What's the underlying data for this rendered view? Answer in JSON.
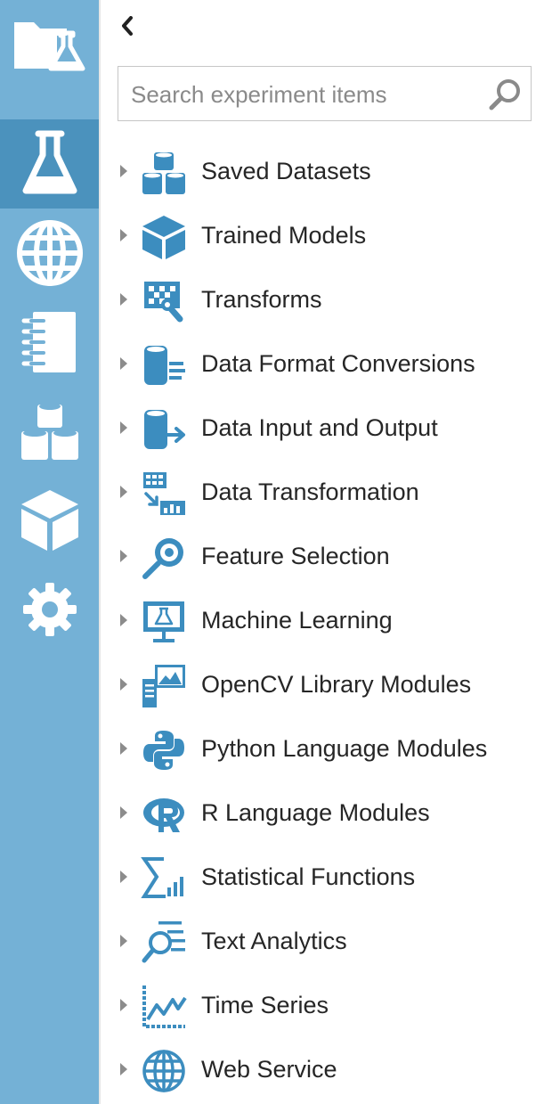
{
  "nav": {
    "items": [
      {
        "icon": "folder-flask-icon",
        "name": "projects"
      },
      {
        "icon": "flask-icon",
        "name": "experiments",
        "active": true
      },
      {
        "icon": "globe-icon",
        "name": "web-services"
      },
      {
        "icon": "notebook-icon",
        "name": "notebooks"
      },
      {
        "icon": "datasets-icon",
        "name": "datasets"
      },
      {
        "icon": "cube-icon",
        "name": "trained-models"
      },
      {
        "icon": "gear-icon",
        "name": "settings"
      }
    ]
  },
  "search": {
    "placeholder": "Search experiment items",
    "value": ""
  },
  "tree": {
    "items": [
      {
        "label": "Saved Datasets",
        "icon": "datasets-icon"
      },
      {
        "label": "Trained Models",
        "icon": "cube-icon"
      },
      {
        "label": "Transforms",
        "icon": "transform-icon"
      },
      {
        "label": "Data Format Conversions",
        "icon": "data-format-icon"
      },
      {
        "label": "Data Input and Output",
        "icon": "data-io-icon"
      },
      {
        "label": "Data Transformation",
        "icon": "data-transformation-icon"
      },
      {
        "label": "Feature Selection",
        "icon": "feature-selection-icon"
      },
      {
        "label": "Machine Learning",
        "icon": "machine-learning-icon"
      },
      {
        "label": "OpenCV Library Modules",
        "icon": "opencv-icon"
      },
      {
        "label": "Python Language Modules",
        "icon": "python-icon"
      },
      {
        "label": "R Language Modules",
        "icon": "r-icon"
      },
      {
        "label": "Statistical Functions",
        "icon": "statistics-icon"
      },
      {
        "label": "Text Analytics",
        "icon": "text-analytics-icon"
      },
      {
        "label": "Time Series",
        "icon": "time-series-icon"
      },
      {
        "label": "Web Service",
        "icon": "globe-icon"
      }
    ]
  },
  "colors": {
    "rail": "#74b1d6",
    "rail_active": "#4b92bd",
    "icon": "#3c8dbf",
    "text": "#262626"
  }
}
